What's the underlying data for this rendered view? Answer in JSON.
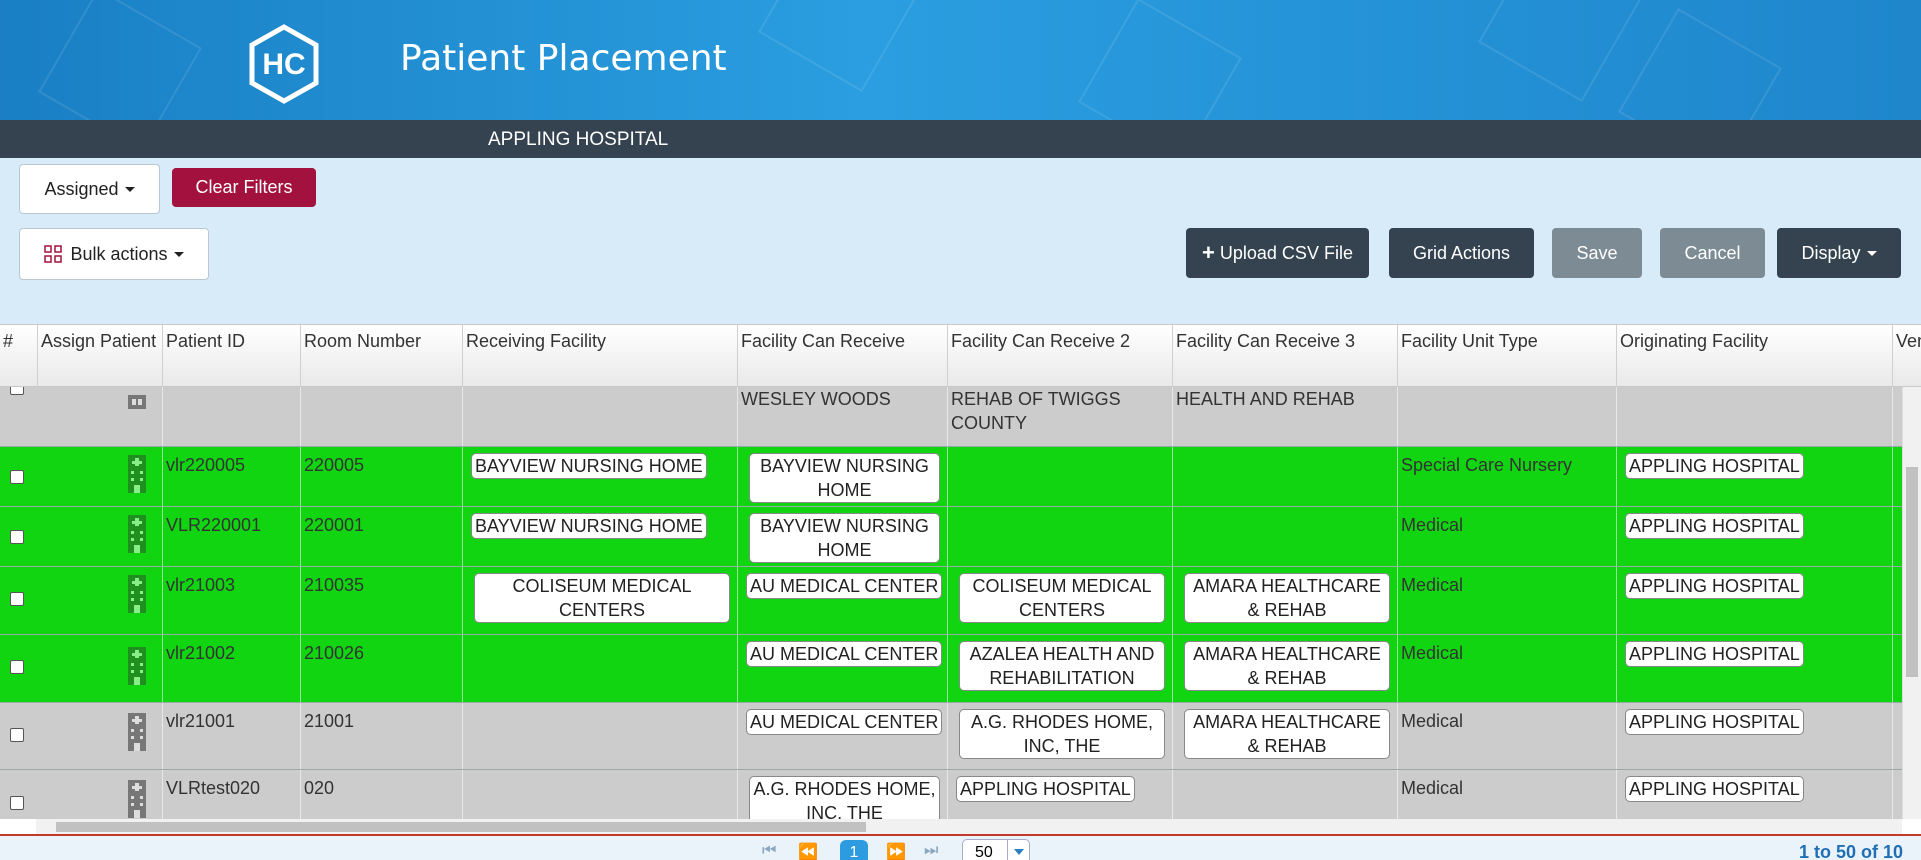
{
  "header": {
    "logo_text": "HC",
    "app_title": "Patient Placement",
    "facility": "APPLING HOSPITAL"
  },
  "toolbar": {
    "assigned_label": "Assigned",
    "clear_filters_label": "Clear Filters",
    "bulk_actions_label": "Bulk actions",
    "upload_csv_label": "Upload CSV File",
    "grid_actions_label": "Grid Actions",
    "save_label": "Save",
    "cancel_label": "Cancel",
    "display_label": "Display"
  },
  "colors": {
    "header_blue": "#2a9ee0",
    "subbar": "#34434f",
    "assigned_row": "#10d510",
    "unassigned_row": "#cccccc",
    "danger": "#a3123f"
  },
  "grid": {
    "columns": [
      "#",
      "Assign Patient",
      "Patient ID",
      "Room Number",
      "Receiving Facility",
      "Facility Can Receive",
      "Facility Can Receive 2",
      "Facility Can Receive 3",
      "Facility Unit Type",
      "Originating Facility",
      "Ven"
    ],
    "partial_row": {
      "fcr": "WESLEY WOODS",
      "fcr2": "REHAB OF TWIGGS COUNTY",
      "fcr3": "HEALTH AND REHAB"
    },
    "rows": [
      {
        "patient_id": "vlr220005",
        "room": "220005",
        "receiving": "BAYVIEW NURSING HOME",
        "fcr": "BAYVIEW NURSING HOME",
        "fcr2": "",
        "fcr3": "",
        "unit": "Special Care Nursery",
        "origin": "APPLING HOSPITAL",
        "status": "assigned"
      },
      {
        "patient_id": "VLR220001",
        "room": "220001",
        "receiving": "BAYVIEW NURSING HOME",
        "fcr": "BAYVIEW NURSING HOME",
        "fcr2": "",
        "fcr3": "",
        "unit": "Medical",
        "origin": "APPLING HOSPITAL",
        "status": "assigned"
      },
      {
        "patient_id": "vlr21003",
        "room": "210035",
        "receiving": "COLISEUM MEDICAL CENTERS",
        "fcr": "AU MEDICAL CENTER",
        "fcr2": "COLISEUM MEDICAL CENTERS",
        "fcr3": "AMARA HEALTHCARE & REHAB",
        "unit": "Medical",
        "origin": "APPLING HOSPITAL",
        "status": "assigned"
      },
      {
        "patient_id": "vlr21002",
        "room": "210026",
        "receiving": "",
        "fcr": "AU MEDICAL CENTER",
        "fcr2": "AZALEA HEALTH AND REHABILITATION",
        "fcr3": "AMARA HEALTHCARE & REHAB",
        "unit": "Medical",
        "origin": "APPLING HOSPITAL",
        "status": "assigned"
      },
      {
        "patient_id": "vlr21001",
        "room": "21001",
        "receiving": "",
        "fcr": "AU MEDICAL CENTER",
        "fcr2": "A.G. RHODES HOME, INC, THE",
        "fcr3": "AMARA HEALTHCARE & REHAB",
        "unit": "Medical",
        "origin": "APPLING HOSPITAL",
        "status": "unassigned"
      },
      {
        "patient_id": "VLRtest020",
        "room": "020",
        "receiving": "",
        "fcr": "A.G. RHODES HOME, INC, THE",
        "fcr2": "APPLING HOSPITAL",
        "fcr3": "",
        "unit": "Medical",
        "origin": "APPLING HOSPITAL",
        "status": "unassigned"
      }
    ]
  },
  "pager": {
    "current_page": "1",
    "page_size": "50",
    "summary": "1 to 50 of 10"
  }
}
